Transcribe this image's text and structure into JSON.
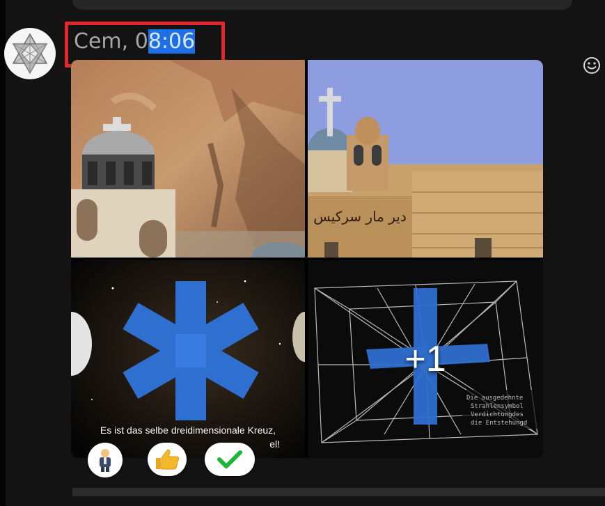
{
  "message": {
    "sender_name": "Cem,",
    "time_prefix": "0",
    "time_selected": "8:06"
  },
  "gallery": {
    "caption_line1": "Es ist das selbe dreidimensionale Kreuz,",
    "caption_line2": "el!",
    "overlay_lines": [
      "Die ausgedehnte",
      "Strahlensymbol",
      "Verdichtungdes",
      "die Entstehungd"
    ],
    "more_count": "+1",
    "sign_text": "دير مار سركيس"
  },
  "reactions": [
    {
      "icon": "person-emoji"
    },
    {
      "icon": "thumbs-up-emoji"
    },
    {
      "icon": "check-mark-emoji"
    }
  ],
  "colors": {
    "highlight_box": "#e0282e",
    "selection": "#1e6ee6",
    "background": "#131313",
    "cross_blue": "#2f6fcf"
  }
}
